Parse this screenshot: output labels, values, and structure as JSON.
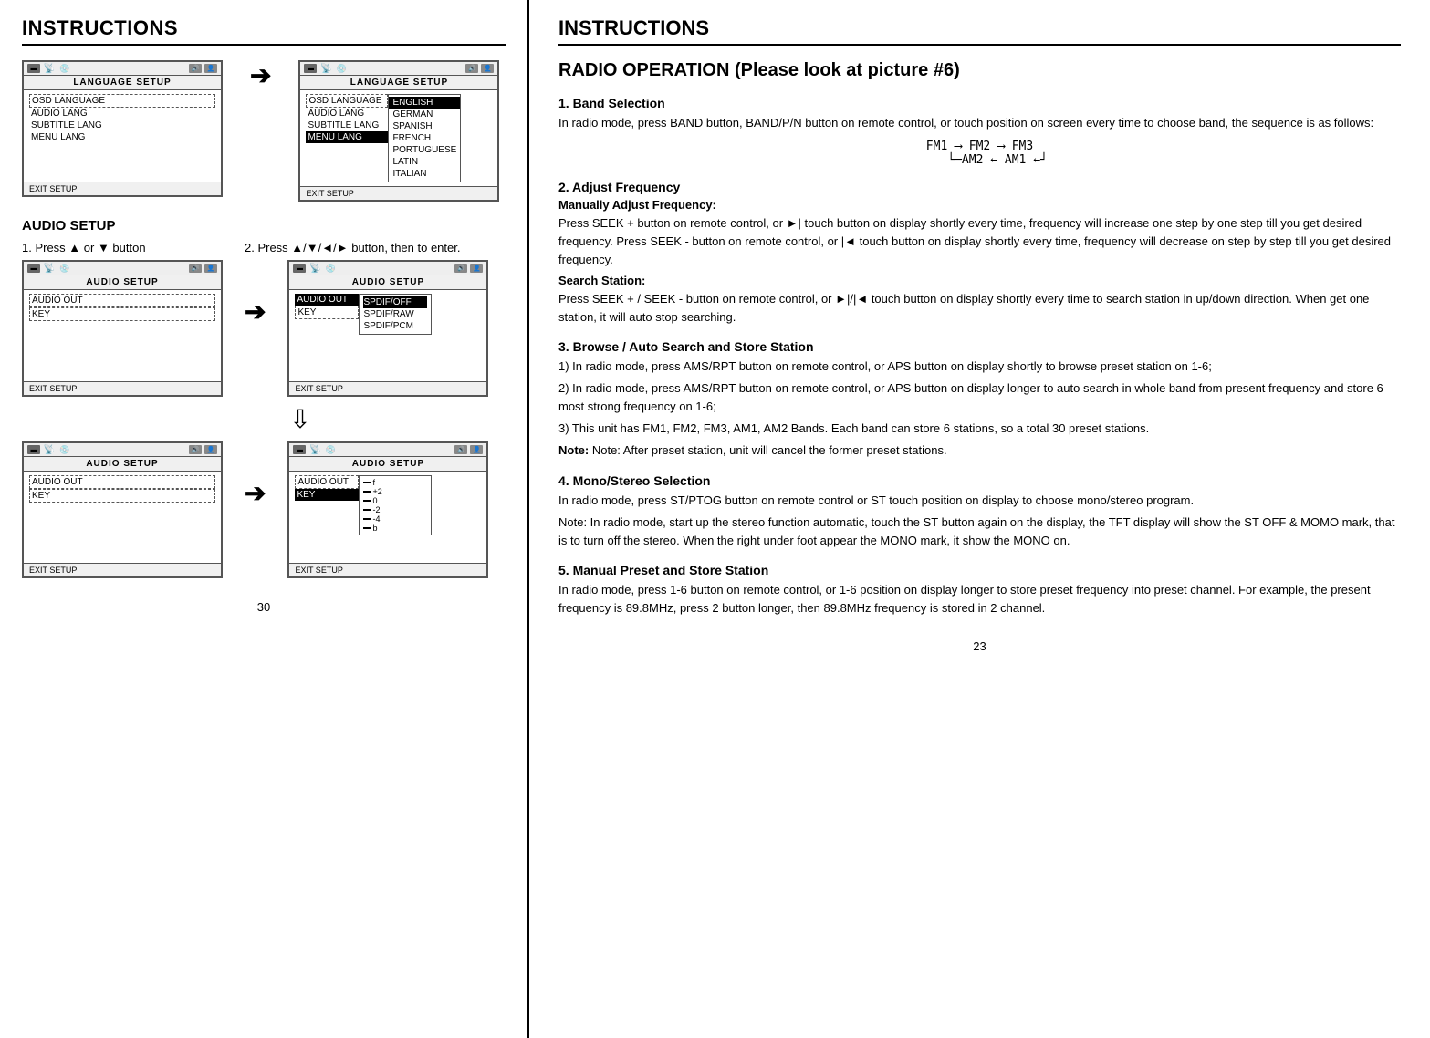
{
  "left": {
    "title": "INSTRUCTIONS",
    "page_number": "30",
    "language_setup": {
      "title": "LANGUAGE SETUP",
      "menu_items": [
        "OSD LANGUAGE",
        "AUDIO LANG",
        "SUBTITLE LANG",
        "MENU LANG"
      ],
      "selected": "MENU LANG",
      "exit": "EXIT SETUP",
      "submenu": [
        "ENGLISH",
        "GERMAN",
        "SPANISH",
        "FRENCH",
        "PORTUGUESE",
        "LATIN",
        "ITALIAN"
      ],
      "submenu_selected": "ENGLISH"
    },
    "audio_setup": {
      "title": "AUDIO SETUP",
      "subsection_label": "AUDIO SETUP",
      "step1_label": "1. Press ▲ or ▼ button",
      "step2_label": "2. Press ▲/▼/◄/► button, then to enter.",
      "menu_items": [
        "AUDIO OUT",
        "KEY"
      ],
      "selected_audio_out": "AUDIO OUT",
      "selected_key": "KEY",
      "exit": "EXIT SETUP",
      "submenu_spdif": [
        "SPDIF/OFF",
        "SPDIF/RAW",
        "SPDIF/PCM"
      ],
      "submenu_spdif_selected": "SPDIF/OFF",
      "key_bars": [
        {
          "label": "f"
        },
        {
          "label": "+2"
        },
        {
          "label": "0"
        },
        {
          "label": "-2"
        },
        {
          "label": "-4"
        },
        {
          "label": "b"
        }
      ]
    }
  },
  "right": {
    "title": "INSTRUCTIONS",
    "page_number": "23",
    "radio_title": "RADIO OPERATION (Please look at picture #6)",
    "sections": [
      {
        "id": "band-selection",
        "heading": "1. Band Selection",
        "paragraphs": [
          "In radio mode, press BAND button, BAND/P/N button on remote control, or touch position on screen every time to choose band, the sequence is as follows:"
        ],
        "band_diagram": "FM1 → FM2 → FM3\n   └─AM2←AM1←┘"
      },
      {
        "id": "adjust-frequency",
        "heading": "2. Adjust Frequency",
        "subheading": "Manually Adjust Frequency:",
        "paragraphs": [
          "Press SEEK + button on remote control, or ►| touch button on display shortly every time, frequency will increase one step by one step till you get desired frequency. Press SEEK - button on remote control, or |◄ touch button on display shortly every time, frequency will decrease on step by step till you get desired frequency."
        ],
        "search_heading": "Search Station:",
        "search_text": "Press SEEK + / SEEK - button on remote control, or ►|/|◄ touch button on display shortly every time to search station in up/down direction. When get one station, it will auto stop searching."
      },
      {
        "id": "browse-auto",
        "heading": "3. Browse / Auto Search and Store Station",
        "paragraphs": [
          "1) In radio mode, press AMS/RPT button on remote control, or APS button on display shortly to browse preset station on 1-6;",
          "2) In radio mode, press AMS/RPT button on remote control, or APS button on display longer to auto search in whole band from present frequency and store 6 most strong frequency on 1-6;",
          "3) This unit has FM1, FM2, FM3, AM1, AM2 Bands. Each band can store 6 stations, so a total 30 preset stations.",
          "Note: After preset station, unit will cancel the former preset stations."
        ]
      },
      {
        "id": "mono-stereo",
        "heading": "4. Mono/Stereo Selection",
        "paragraphs": [
          "In radio mode, press ST/PTOG button on remote control or ST touch position on display to choose mono/stereo program.",
          "Note: In radio mode, start up the stereo function automatic, touch the ST button again on the display, the TFT display will show the ST OFF & MOMO mark, that is to turn off the stereo. When the right under foot appear the MONO mark, it show the MONO on."
        ]
      },
      {
        "id": "manual-preset",
        "heading": "5.  Manual Preset and Store Station",
        "paragraphs": [
          "In radio mode, press 1-6 button on remote control, or 1-6 position on display longer to store preset frequency into preset channel. For example, the present frequency is 89.8MHz, press 2 button longer, then 89.8MHz frequency is stored in 2 channel."
        ]
      }
    ]
  }
}
